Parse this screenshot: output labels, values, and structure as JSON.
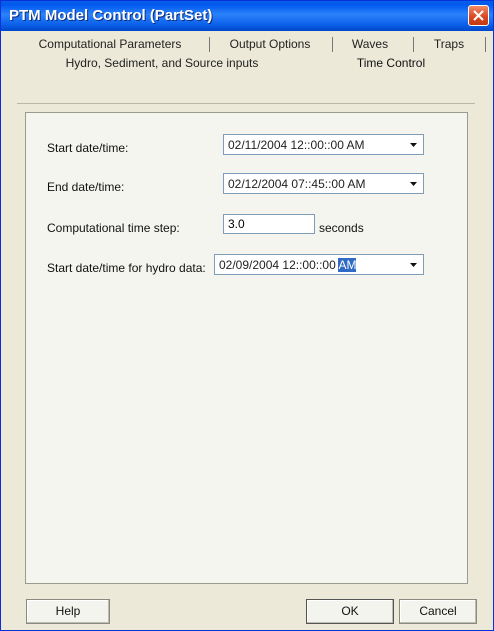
{
  "window": {
    "title": "PTM Model Control (PartSet)"
  },
  "tabs": {
    "row1": [
      "Computational Parameters",
      "Output Options",
      "Waves",
      "Traps"
    ],
    "row2": [
      "Hydro, Sediment, and Source inputs",
      "Time Control"
    ],
    "active": "Time Control"
  },
  "form": {
    "start_label": "Start date/time:",
    "start_value": "02/11/2004  12::00::00 AM",
    "end_label": "End date/time:",
    "end_value": "02/12/2004  07::45::00 AM",
    "step_label": "Computational time step:",
    "step_value": "3.0",
    "step_unit": "seconds",
    "hydro_label": "Start date/time for hydro data:",
    "hydro_value_main": "02/09/2004  12::00::00 ",
    "hydro_value_selected": "AM"
  },
  "buttons": {
    "help": "Help",
    "ok": "OK",
    "cancel": "Cancel"
  },
  "icons": {
    "close": "close-icon",
    "dropdown": "chevron-down-icon"
  }
}
